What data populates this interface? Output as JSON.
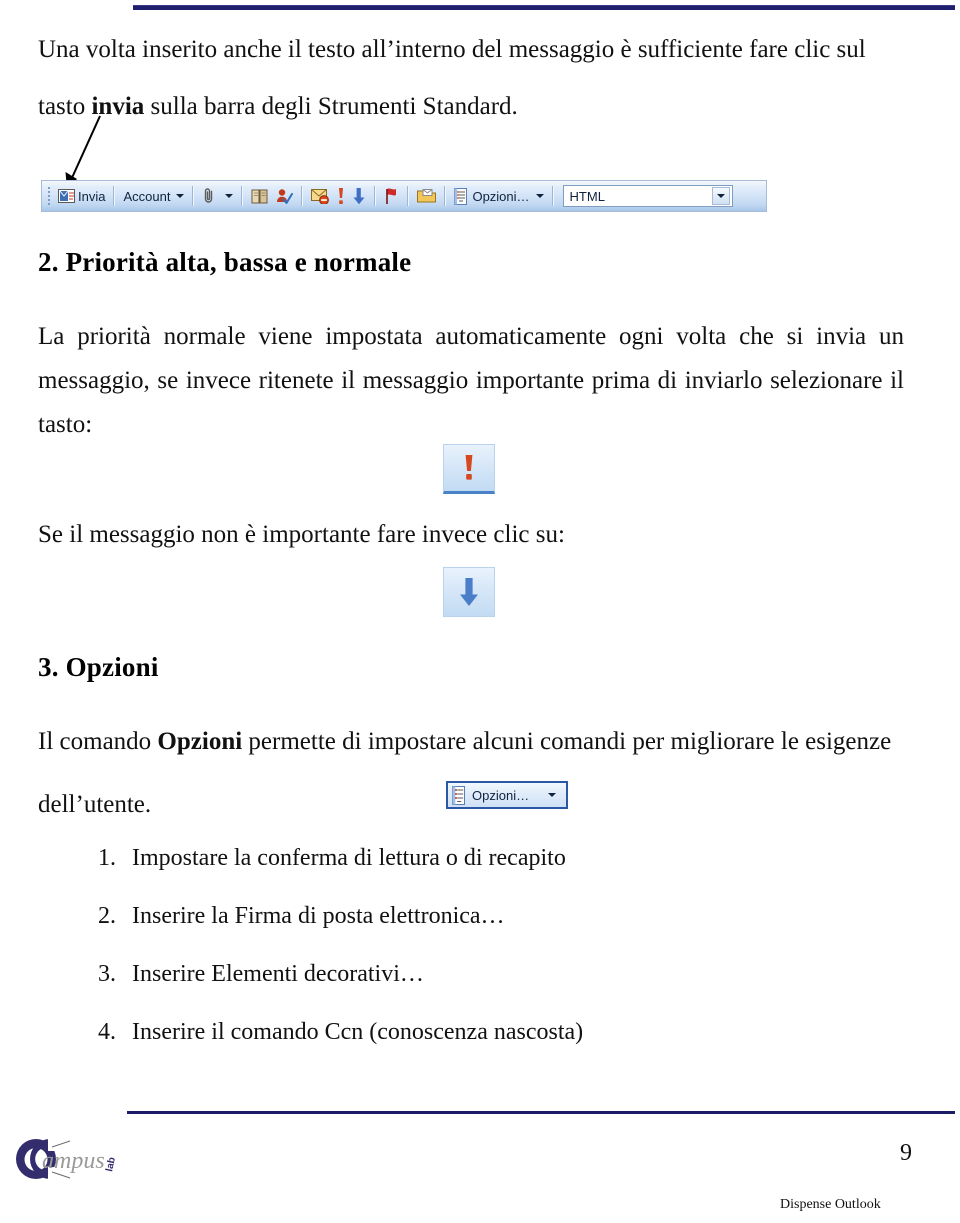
{
  "document": {
    "page_number": "9",
    "footer_label": "Dispense Outlook",
    "logo": {
      "main_text": "ampus",
      "sub_text": "lab",
      "ring_color": "#332d6e",
      "text_color": "#9a9a9a"
    },
    "rule_color": "#1f1f6e"
  },
  "body": {
    "intro_line1": "Una volta inserito anche il testo all’interno del messaggio è sufficiente fare clic sul",
    "intro_line2_pre": "tasto ",
    "intro_line2_bold": "invia ",
    "intro_line2_post": "sulla barra degli Strumenti Standard.",
    "section2_heading": "2. Priorità alta, bassa e normale",
    "section2_para": "La priorità normale viene impostata automaticamente ogni volta che si invia un messaggio, se invece ritenete il messaggio importante prima di inviarlo selezionare il tasto:",
    "low_priority_intro": "Se il messaggio non è importante fare invece clic su:",
    "section3_heading": "3. Opzioni",
    "section3_para_pre": "Il comando ",
    "section3_para_bold": "Opzioni",
    "section3_para_post": " permette di impostare alcuni comandi per migliorare le esigenze",
    "section3_para_line2": "dell’utente.",
    "options_list": [
      {
        "num": "1.",
        "text": "Impostare la conferma di lettura o di recapito"
      },
      {
        "num": "2.",
        "text": "Inserire la Firma di posta elettronica…",
        "underline_char": "F"
      },
      {
        "num": "3.",
        "text": "Inserire Elementi decorativi…"
      },
      {
        "num": "4.",
        "text": "Inserire il comando Ccn  (conoscenza nascosta)"
      }
    ]
  },
  "toolbar": {
    "name": "outlook-standard-toolbar",
    "grip_label": "toolbar-grip",
    "send_button": "Invia",
    "account_button": "Account",
    "attach_button": "",
    "addressbook_button": "",
    "checknames_button": "",
    "blockmsg_button": "",
    "high_priority_button": "",
    "low_priority_button": "",
    "flag_button": "",
    "folder_button": "",
    "options_button": "Opzioni…",
    "format_combo_value": "HTML"
  },
  "callouts": {
    "high_priority_icon_label": "!",
    "low_priority_icon_label": "↓",
    "options_button_label": "Opzioni…"
  },
  "colors": {
    "toolbar_border": "#a7bcd6",
    "toolbar_bg_top": "#f4f8fd",
    "toolbar_bg_bottom": "#a9c7ea",
    "priority_high": "#d6481f",
    "priority_low": "#3e6fc4",
    "options_border": "#2b57a6",
    "rule_navy": "#1f1f6e"
  }
}
